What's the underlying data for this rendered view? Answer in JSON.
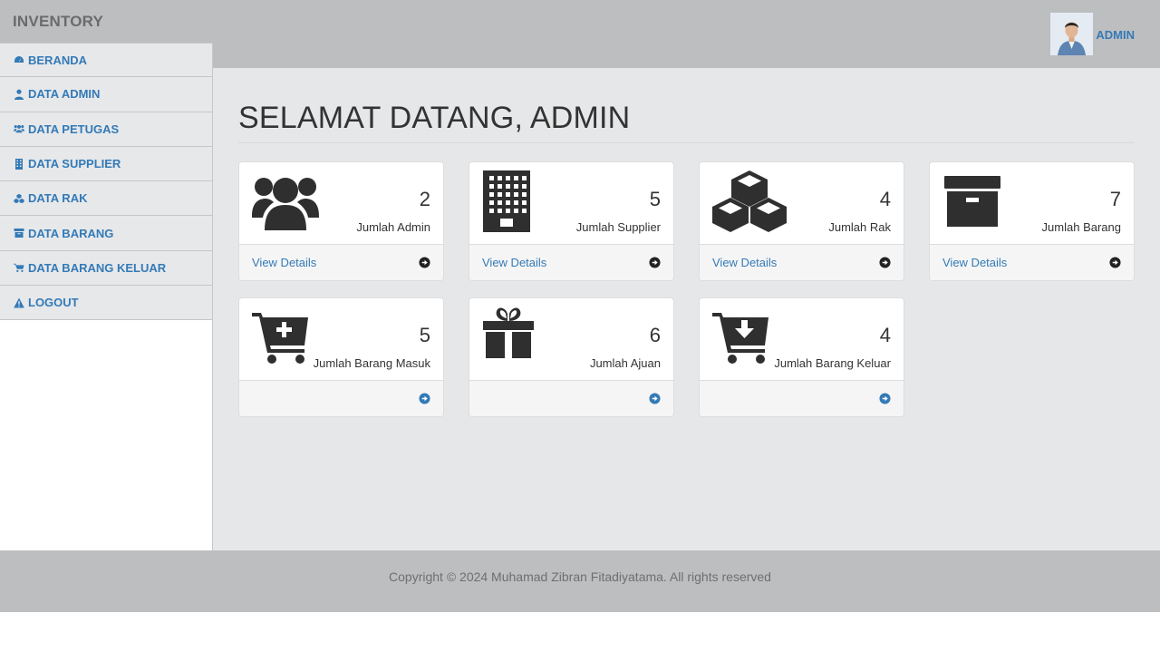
{
  "app": {
    "brand": "INVENTORY",
    "user_name": "ADMIN"
  },
  "colors": {
    "accent": "#337ab7",
    "topbar": "#bdbec0",
    "main_bg": "#e6e7e9",
    "sidebar_item_bg": "#e7e8ea"
  },
  "sidebar": {
    "items": [
      {
        "label": "BERANDA",
        "icon": "dashboard-icon"
      },
      {
        "label": "DATA ADMIN",
        "icon": "user-icon"
      },
      {
        "label": "DATA PETUGAS",
        "icon": "users-icon"
      },
      {
        "label": "DATA SUPPLIER",
        "icon": "building-icon"
      },
      {
        "label": "DATA RAK",
        "icon": "cubes-icon"
      },
      {
        "label": "DATA BARANG",
        "icon": "archive-icon"
      },
      {
        "label": "DATA BARANG KELUAR",
        "icon": "cart-icon"
      },
      {
        "label": "LOGOUT",
        "icon": "warning-icon"
      }
    ]
  },
  "main": {
    "title": "SELAMAT DATANG, ADMIN",
    "cards": [
      {
        "count": "2",
        "label": "Jumlah Admin",
        "link": "View Details",
        "icon": "users-icon"
      },
      {
        "count": "5",
        "label": "Jumlah Supplier",
        "link": "View Details",
        "icon": "building-icon"
      },
      {
        "count": "4",
        "label": "Jumlah Rak",
        "link": "View Details",
        "icon": "cubes-icon"
      },
      {
        "count": "7",
        "label": "Jumlah Barang",
        "link": "View Details",
        "icon": "archive-icon"
      },
      {
        "count": "5",
        "label": "Jumlah Barang Masuk",
        "link": "",
        "icon": "cart-plus-icon"
      },
      {
        "count": "6",
        "label": "Jumlah Ajuan",
        "link": "",
        "icon": "gift-icon"
      },
      {
        "count": "4",
        "label": "Jumlah Barang Keluar",
        "link": "",
        "icon": "cart-arrow-down-icon"
      }
    ]
  },
  "footer": {
    "copyright": "Copyright © 2024 Muhamad Zibran Fitadiyatama. All rights reserved"
  }
}
